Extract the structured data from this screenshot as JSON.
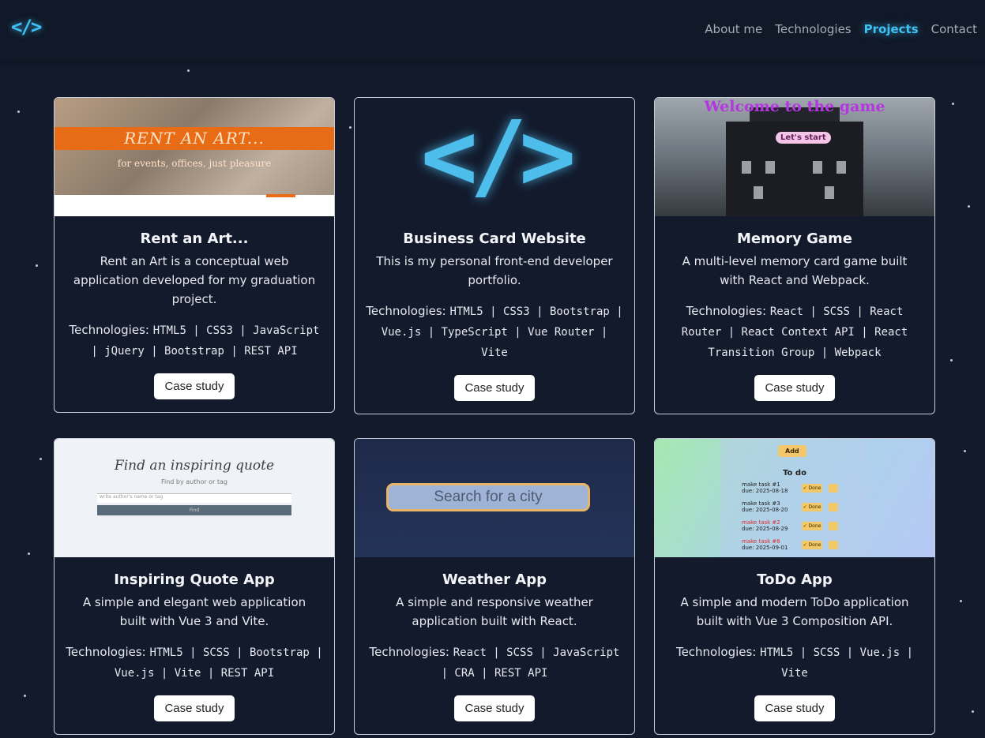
{
  "nav": {
    "logo": "</>",
    "links": [
      {
        "label": "About me",
        "active": false
      },
      {
        "label": "Technologies",
        "active": false
      },
      {
        "label": "Projects",
        "active": true
      },
      {
        "label": "Contact",
        "active": false
      }
    ]
  },
  "projects": [
    {
      "title": "Rent an Art...",
      "description": "Rent an Art is a conceptual web application developed for my graduation project.",
      "tech_label": "Technologies:",
      "tech_list": "HTML5 | CSS3 | JavaScript | jQuery | Bootstrap | REST API",
      "button": "Case study",
      "thumb": {
        "heading": "RENT AN ART...",
        "subheading": "for events, offices, just pleasure"
      }
    },
    {
      "title": "Business Card Website",
      "description": "This is my personal front-end developer portfolio.",
      "tech_label": "Technologies:",
      "tech_list": "HTML5 | CSS3 | Bootstrap | Vue.js | TypeScript | Vue Router | Vite",
      "button": "Case study",
      "thumb": {
        "glyph": "</>"
      }
    },
    {
      "title": "Memory Game",
      "description": "A multi-level memory card game built with React and Webpack.",
      "tech_label": "Technologies:",
      "tech_list": "React | SCSS | React Router | React Context API | React Transition Group | Webpack",
      "button": "Case study",
      "thumb": {
        "heading": "Welcome to the game",
        "button": "Let's start"
      }
    },
    {
      "title": "Inspiring Quote App",
      "description": "A simple and elegant web application built with Vue 3 and Vite.",
      "tech_label": "Technologies:",
      "tech_list": "HTML5 | SCSS | Bootstrap | Vue.js | Vite | REST API",
      "button": "Case study",
      "thumb": {
        "heading": "Find an inspiring quote",
        "subheading": "Find by author or tag",
        "placeholder": "write author's name or tag",
        "button": "Find"
      }
    },
    {
      "title": "Weather App",
      "description": "A simple and responsive weather application built with React.",
      "tech_label": "Technologies:",
      "tech_list": "React | SCSS | JavaScript | CRA | REST API",
      "button": "Case study",
      "thumb": {
        "placeholder": "Search for a city"
      }
    },
    {
      "title": "ToDo App",
      "description": "A simple and modern ToDo application built with Vue 3 Composition API.",
      "tech_label": "Technologies:",
      "tech_list": "HTML5 | SCSS | Vue.js | Vite",
      "button": "Case study",
      "thumb": {
        "add": "Add",
        "heading": "To do",
        "tasks": [
          {
            "name": "make task #1",
            "due": "due: 2025-08-18"
          },
          {
            "name": "make task #3",
            "due": "due: 2025-08-20"
          },
          {
            "name": "make task #2",
            "due": "due: 2025-08-29"
          },
          {
            "name": "make task #6",
            "due": "due: 2025-09-01"
          }
        ],
        "done": "✓ Done"
      }
    }
  ]
}
